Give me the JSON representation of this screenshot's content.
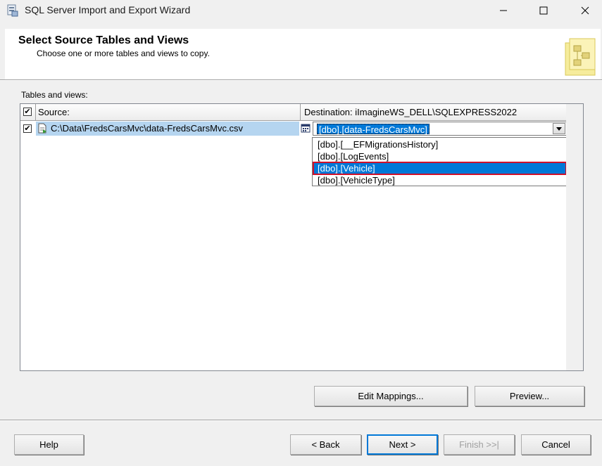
{
  "window": {
    "title": "SQL Server Import and Export Wizard"
  },
  "header": {
    "title": "Select Source Tables and Views",
    "subtitle": "Choose one or more tables and views to copy."
  },
  "tables_label": "Tables and views:",
  "grid": {
    "columns": {
      "source": "Source:",
      "destination": "Destination: iImagineWS_DELL\\SQLEXPRESS2022"
    },
    "rows": [
      {
        "checked": true,
        "source": "C:\\Data\\FredsCarsMvc\\data-FredsCarsMvc.csv",
        "destination": "[dbo].[data-FredsCarsMvc]"
      }
    ],
    "dropdown_options": [
      "[dbo].[__EFMigrationsHistory]",
      "[dbo].[LogEvents]",
      "[dbo].[Vehicle]",
      "[dbo].[VehicleType]"
    ],
    "selected_option": "[dbo].[Vehicle]"
  },
  "buttons": {
    "edit_mappings": "Edit Mappings...",
    "preview": "Preview...",
    "help": "Help",
    "back": "< Back",
    "next": "Next >",
    "finish": "Finish >>|",
    "cancel": "Cancel"
  },
  "colors": {
    "selection": "#0078d7",
    "row_highlight": "#b5d5f0",
    "highlight_outline": "#d0102a"
  }
}
